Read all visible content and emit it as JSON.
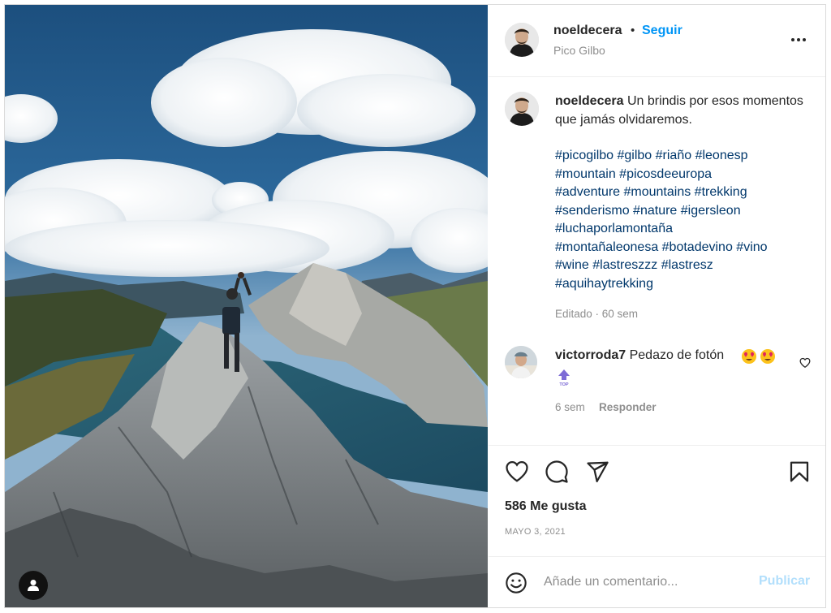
{
  "post": {
    "username": "noeldecera",
    "follow_label": "Seguir",
    "separator": "•",
    "location": "Pico Gilbo",
    "more_icon": "more-horizontal-icon"
  },
  "caption": {
    "username": "noeldecera",
    "text": "Un brindis por esos momentos que jamás olvidaremos.",
    "hashtag_lines": [
      "#picogilbo #gilbo #riaño #leonesp",
      "#mountain #picosdeeuropa",
      "#adventure #mountains #trekking",
      "#senderismo #nature #igersleon",
      "#luchaporlamontaña",
      "#montañaleonesa #botadevino #vino",
      "#wine #lastreszzz #lastresz",
      "#aquihaytrekking"
    ],
    "edited_label": "Editado · 60 sem"
  },
  "comment": {
    "username": "victorroda7",
    "text": "Pedazo de fotón",
    "emojis": [
      "heart-eyes-emoji",
      "heart-eyes-emoji",
      "top-arrow-emoji"
    ],
    "time": "6 sem",
    "reply_label": "Responder"
  },
  "actions": {
    "likes": "586 Me gusta",
    "date": "MAYO 3, 2021",
    "icons": [
      "heart-icon",
      "comment-icon",
      "share-icon",
      "bookmark-icon"
    ]
  },
  "add_comment": {
    "placeholder": "Añade un comentario...",
    "publish_label": "Publicar",
    "publish_color": "#b2dffc"
  },
  "colors": {
    "link": "#0095f6",
    "hashtag": "#00376b",
    "muted": "#8e8e8e"
  }
}
